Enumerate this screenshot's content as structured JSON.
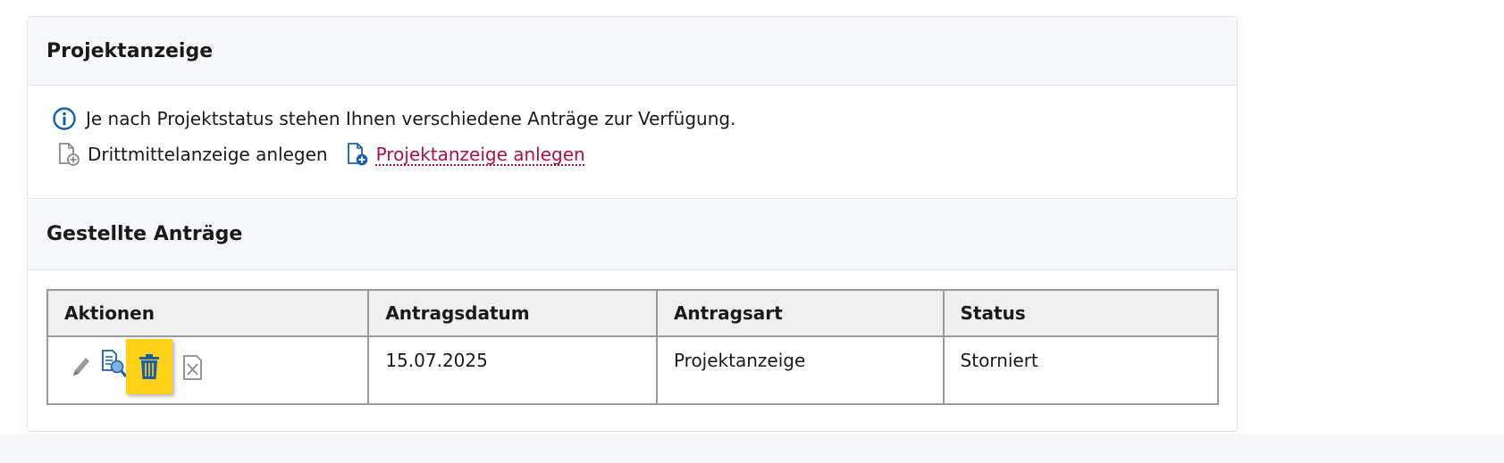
{
  "project_section": {
    "title": "Projektanzeige",
    "info_text": "Je nach Projektstatus stehen Ihnen verschiedene Anträge zur Verfügung.",
    "actions": [
      {
        "label": "Drittmittelanzeige anlegen",
        "icon": "document-add-icon",
        "state": "disabled"
      },
      {
        "label": "Projektanzeige anlegen",
        "icon": "document-add-icon",
        "state": "link"
      }
    ]
  },
  "requests_section": {
    "title": "Gestellte Anträge",
    "columns": [
      "Aktionen",
      "Antragsdatum",
      "Antragsart",
      "Status"
    ],
    "rows": [
      {
        "actions": [
          "edit-icon",
          "view-document-icon",
          "delete-icon",
          "cancel-icon"
        ],
        "date": "15.07.2025",
        "type": "Projektanzeige",
        "status": "Storniert"
      }
    ]
  },
  "colors": {
    "link": "#b0113a",
    "info_blue": "#1a5fa8",
    "highlight": "#ffd119"
  }
}
